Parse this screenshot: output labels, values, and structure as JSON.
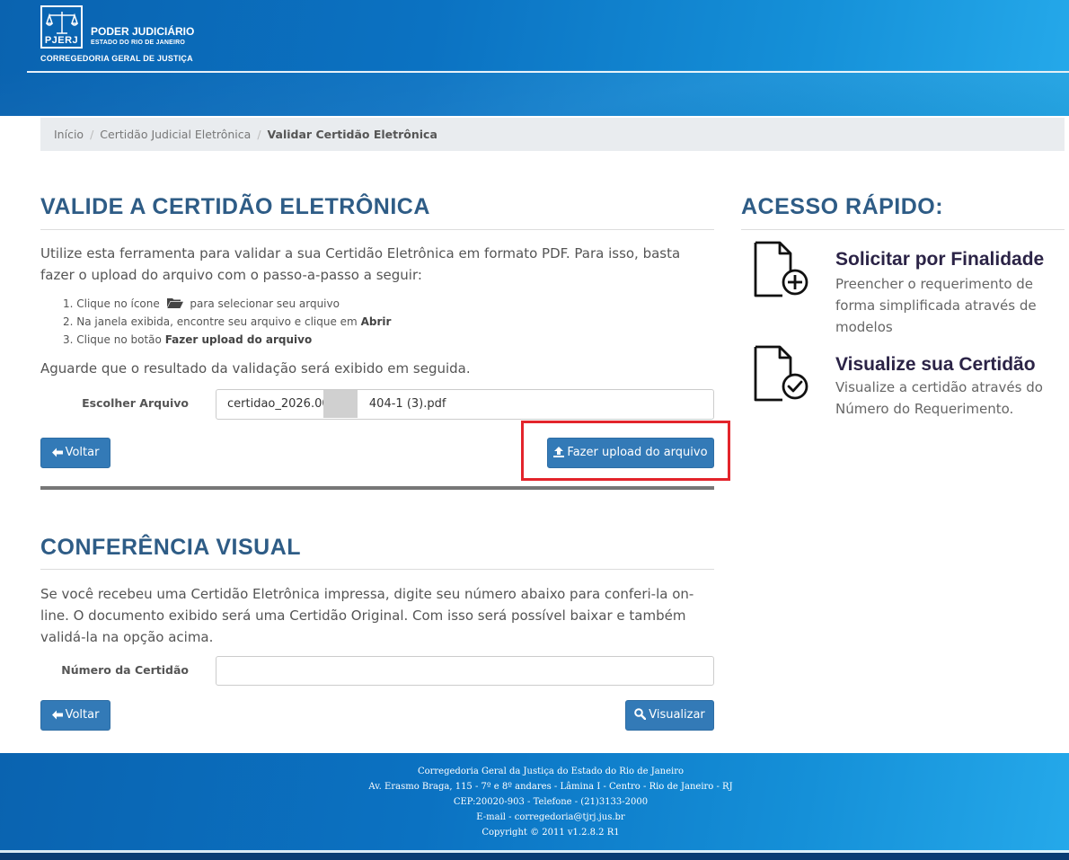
{
  "header": {
    "logo_text": "PJERJ",
    "org_line1": "PODER JUDICIÁRIO",
    "org_line2": "ESTADO DO RIO DE JANEIRO",
    "org_line3": "CORREGEDORIA GERAL DE JUSTIÇA"
  },
  "breadcrumb": {
    "items": [
      "Início",
      "Certidão Judicial Eletrônica",
      "Validar Certidão Eletrônica"
    ],
    "separator": "/"
  },
  "validate": {
    "title": "VALIDE A CERTIDÃO ELETRÔNICA",
    "intro": "Utilize esta ferramenta para validar a sua Certidão Eletrônica em formato PDF. Para isso, basta fazer o upload do arquivo com o passo-a-passo a seguir:",
    "step1_a": "1. Clique no ícone",
    "step1_b": "para selecionar seu arquivo",
    "step2_a": "2. Na janela exibida, encontre seu arquivo e clique em",
    "step2_b": "Abrir",
    "step3_a": "3. Clique no botão",
    "step3_b": "Fazer upload do arquivo",
    "wait_text": "Aguarde que o resultado da validação será exibido em seguida.",
    "file_label": "Escolher Arquivo",
    "file_value_start": "certidao_2026.006",
    "file_value_end": "404-1 (3).pdf",
    "back_label": "Voltar",
    "upload_label": "Fazer upload do arquivo"
  },
  "visual": {
    "title": "CONFERÊNCIA VISUAL",
    "intro": "Se você recebeu uma Certidão Eletrônica impressa, digite seu número abaixo para conferi-la on-line. O documento exibido será uma Certidão Original. Com isso será possível baixar e também validá-la na opção acima.",
    "number_label": "Número da Certidão",
    "number_value": "",
    "back_label": "Voltar",
    "view_label": "Visualizar"
  },
  "quick_access": {
    "title": "ACESSO RÁPIDO:",
    "items": [
      {
        "title": "Solicitar por Finalidade",
        "desc": "Preencher o requerimento de forma simplificada através de modelos",
        "icon": "document-plus-icon"
      },
      {
        "title": "Visualize sua Certidão",
        "desc": "Visualize a certidão através do Número do Requerimento.",
        "icon": "document-check-icon"
      }
    ]
  },
  "footer": {
    "line1": "Corregedoria Geral da Justiça do Estado do Rio de Janeiro",
    "line2": "Av. Erasmo Braga, 115 - 7º e 8º andares - Lâmina I - Centro - Rio de Janeiro - RJ",
    "line3": "CEP:20020-903 - Telefone - (21)3133-2000",
    "line4": "E-mail - corregedoria@tjrj.jus.br",
    "line5": "Copyright © 2011 v1.2.8.2 R1"
  },
  "colors": {
    "header_blue": "#0b72c2",
    "heading": "#2e5c86",
    "button": "#337ab7",
    "highlight": "#e3242b"
  }
}
